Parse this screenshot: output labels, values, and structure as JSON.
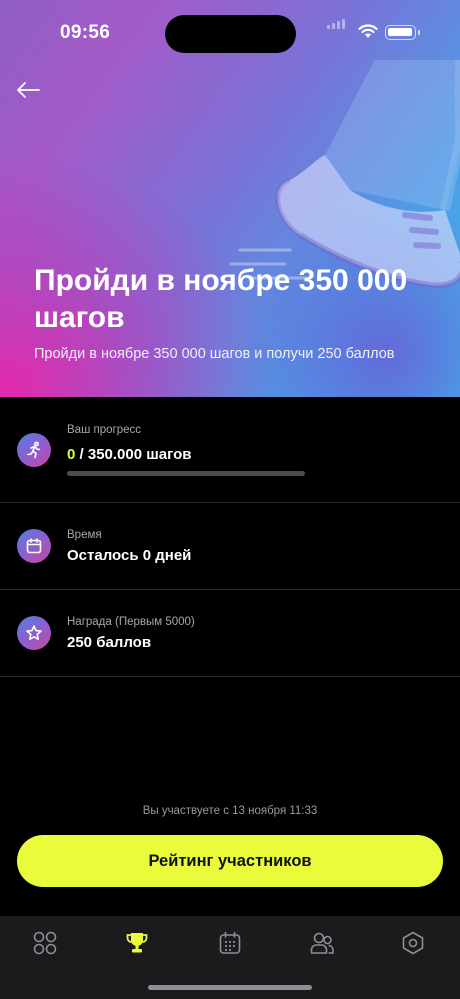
{
  "status_bar": {
    "time": "09:56"
  },
  "hero": {
    "title": "Пройди в ноябре 350 000 шагов",
    "subtitle": "Пройди в ноябре 350 000 шагов и получи 250 баллов",
    "gradient_colors": [
      "#e02ab0",
      "#8f5fc4",
      "#3fb6ec"
    ]
  },
  "progress": {
    "label": "Ваш прогресс",
    "current": "0",
    "goal": " / 350.000 шагов",
    "fraction": 0,
    "icon": "runner-icon"
  },
  "time": {
    "label": "Время",
    "value": "Осталось 0 дней",
    "icon": "calendar-icon"
  },
  "reward": {
    "label": "Награда (Первым 5000)",
    "value": "250 баллов",
    "icon": "star-icon"
  },
  "footer": {
    "participation_note": "Вы участвуете с 13 ноября 11:33",
    "rating_button_label": "Рейтинг участников",
    "accent_color": "#e9fb3a"
  },
  "tab_bar": {
    "tabs": [
      {
        "icon": "grid-icon",
        "active": false
      },
      {
        "icon": "trophy-icon",
        "active": true
      },
      {
        "icon": "calendar-icon",
        "active": false
      },
      {
        "icon": "people-icon",
        "active": false
      },
      {
        "icon": "hexagon-icon",
        "active": false
      }
    ]
  }
}
